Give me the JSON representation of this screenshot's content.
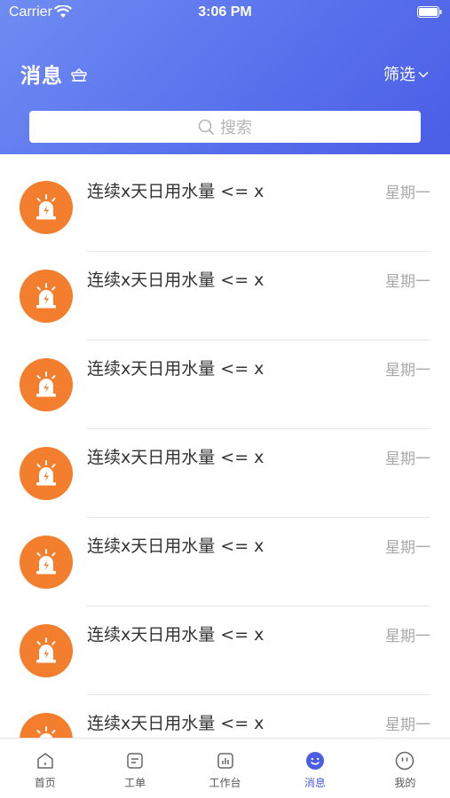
{
  "status_bar": {
    "carrier": "Carrier",
    "time": "3:06 PM"
  },
  "header": {
    "title": "消息",
    "filter_label": "筛选"
  },
  "search": {
    "placeholder": "搜索"
  },
  "messages": [
    {
      "title": "连续x天日用水量 <= x",
      "time": "星期一"
    },
    {
      "title": "连续x天日用水量 <= x",
      "time": "星期一"
    },
    {
      "title": "连续x天日用水量 <= x",
      "time": "星期一"
    },
    {
      "title": "连续x天日用水量 <= x",
      "time": "星期一"
    },
    {
      "title": "连续x天日用水量 <= x",
      "time": "星期一"
    },
    {
      "title": "连续x天日用水量 <= x",
      "time": "星期一"
    },
    {
      "title": "连续x天日用水量 <= x",
      "time": "星期一"
    }
  ],
  "tabs": [
    {
      "label": "首页",
      "icon": "home-icon",
      "active": false
    },
    {
      "label": "工单",
      "icon": "work-order-icon",
      "active": false
    },
    {
      "label": "工作台",
      "icon": "dashboard-icon",
      "active": false
    },
    {
      "label": "消息",
      "icon": "message-icon",
      "active": true
    },
    {
      "label": "我的",
      "icon": "profile-icon",
      "active": false
    }
  ],
  "colors": {
    "accent": "#4a5de6",
    "header_gradient_start": "#6f8cf2",
    "avatar_orange": "#f37e2d"
  }
}
